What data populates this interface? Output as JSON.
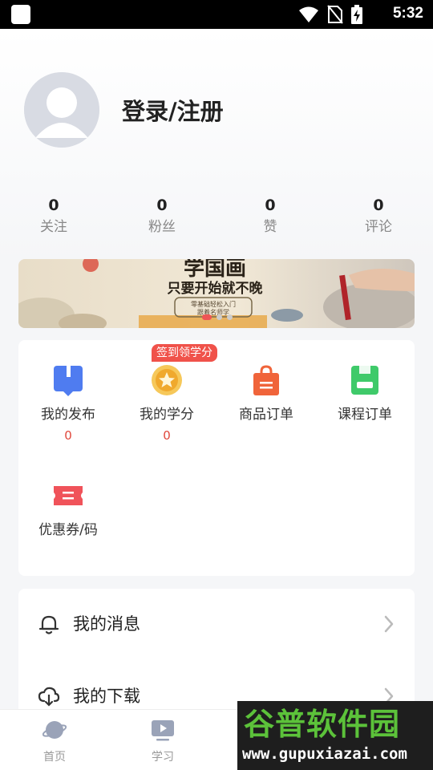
{
  "status_bar": {
    "time": "5:32",
    "icons": [
      "wifi-icon",
      "no-sim-icon",
      "battery-charging-icon"
    ]
  },
  "profile": {
    "login_label": "登录/注册"
  },
  "stats": [
    {
      "value": "0",
      "label": "关注"
    },
    {
      "value": "0",
      "label": "粉丝"
    },
    {
      "value": "0",
      "label": "赞"
    },
    {
      "value": "0",
      "label": "评论"
    }
  ],
  "banner": {
    "title": "学国画",
    "subtitle": "只要开始就不晚",
    "caption_line1": "零基础轻松入门",
    "caption_line2": "跟着名师学"
  },
  "features": {
    "signin_badge": "签到领学分",
    "items": [
      {
        "label": "我的发布",
        "count": "0",
        "icon": "publish-icon",
        "color": "#4f7cf0"
      },
      {
        "label": "我的学分",
        "count": "0",
        "icon": "credit-star-icon",
        "color": "#f4b43a"
      },
      {
        "label": "商品订单",
        "icon": "shopping-bag-icon",
        "color": "#f0643a"
      },
      {
        "label": "课程订单",
        "icon": "course-order-icon",
        "color": "#3fca6a"
      },
      {
        "label": "优惠券/码",
        "icon": "coupon-icon",
        "color": "#f0535a"
      }
    ]
  },
  "menu": {
    "items": [
      {
        "label": "我的消息",
        "icon": "bell-icon"
      },
      {
        "label": "我的下载",
        "icon": "cloud-download-icon"
      }
    ]
  },
  "tabbar": {
    "items": [
      {
        "label": "首页",
        "icon": "planet-icon"
      },
      {
        "label": "学习",
        "icon": "play-icon"
      }
    ]
  },
  "watermark": {
    "title": "谷普软件园",
    "url": "www.gupuxiazai.com"
  }
}
